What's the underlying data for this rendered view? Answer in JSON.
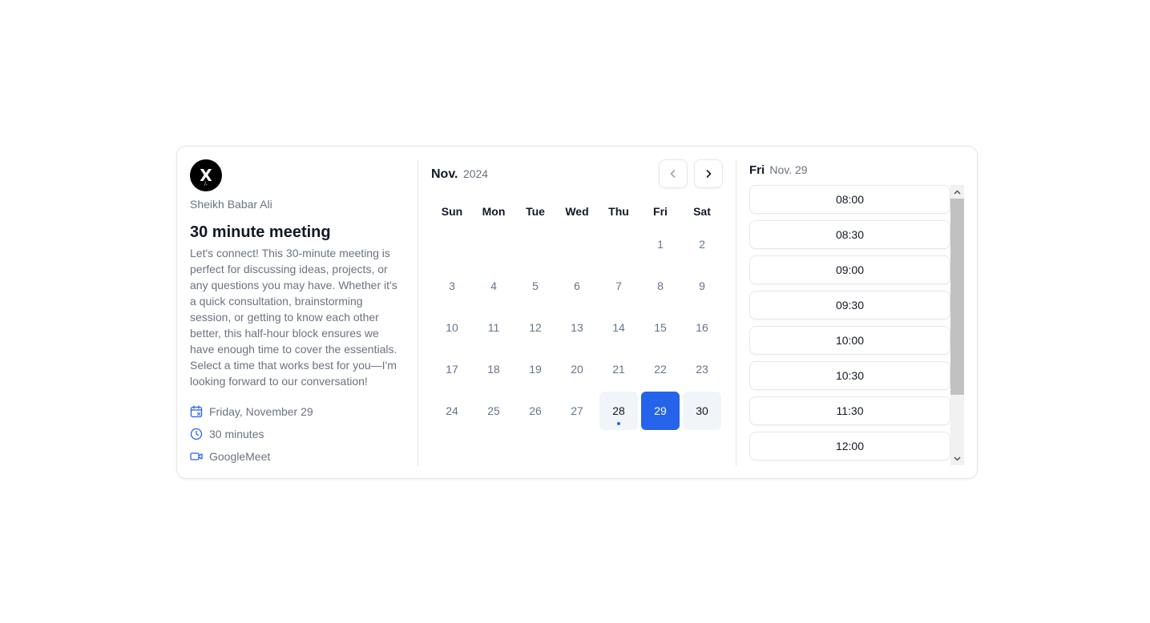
{
  "host": {
    "avatar_letter": "X",
    "avatar_mark": "/,",
    "name": "Sheikh Babar Ali"
  },
  "meeting": {
    "title": "30 minute meeting",
    "description": "Let's connect! This 30-minute meeting is perfect for discussing ideas, projects, or any questions you may have. Whether it's a quick consultation, brainstorming session, or getting to know each other better, this half-hour block ensures we have enough time to cover the essentials. Select a time that works best for you—I'm looking forward to our conversation!",
    "date": "Friday, November 29",
    "duration": "30 minutes",
    "location": "GoogleMeet",
    "icons": [
      "calendar-icon",
      "clock-icon",
      "video-icon"
    ]
  },
  "calendar": {
    "month": "Nov.",
    "year": "2024",
    "weekdays": [
      "Sun",
      "Mon",
      "Tue",
      "Wed",
      "Thu",
      "Fri",
      "Sat"
    ],
    "leading_blank_days": 5,
    "days_in_month": 30,
    "today": 28,
    "selected": 29,
    "available": [
      28,
      29,
      30
    ],
    "colors": {
      "accent": "#2563eb",
      "available_bg": "#f1f5f9",
      "muted_text": "#64748b"
    }
  },
  "slots": {
    "day": "Fri",
    "date": "Nov. 29",
    "times": [
      "08:00",
      "08:30",
      "09:00",
      "09:30",
      "10:00",
      "10:30",
      "11:30",
      "12:00"
    ]
  }
}
